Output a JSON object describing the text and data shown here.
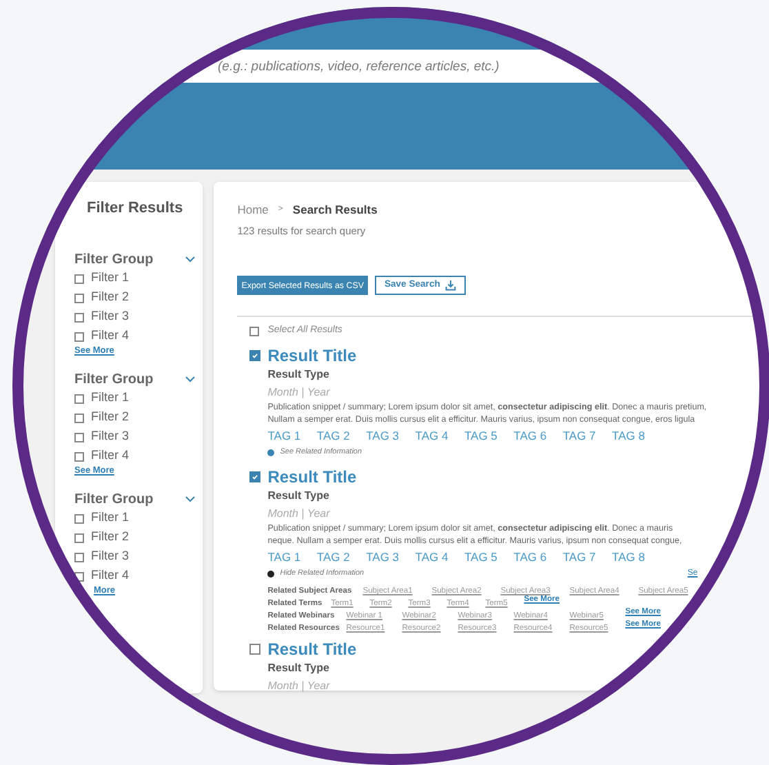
{
  "search": {
    "placeholder": "(e.g.: publications, video, reference articles, etc.)"
  },
  "filters": {
    "title": "Filter Results",
    "groups": [
      {
        "label": "Filter Group",
        "expanded": true,
        "items": [
          {
            "label": "Filter 1",
            "checked": false
          },
          {
            "label": "Filter 2",
            "checked": false
          },
          {
            "label": "Filter 3",
            "checked": false
          },
          {
            "label": "Filter 4",
            "checked": false
          }
        ],
        "see_more": "See More"
      },
      {
        "label": "Filter Group",
        "expanded": true,
        "items": [
          {
            "label": "Filter 1",
            "checked": false
          },
          {
            "label": "Filter 2",
            "checked": false
          },
          {
            "label": "Filter 3",
            "checked": false
          },
          {
            "label": "Filter 4",
            "checked": false
          }
        ],
        "see_more": "See More"
      },
      {
        "label": "Filter Group",
        "expanded": true,
        "items": [
          {
            "label": "Filter 1",
            "checked": false
          },
          {
            "label": "Filter 2",
            "checked": false
          },
          {
            "label": "Filter 3",
            "checked": false
          },
          {
            "label": "Filter 4",
            "checked": false
          }
        ],
        "see_more": "More"
      }
    ]
  },
  "breadcrumb": [
    {
      "label": "Home",
      "current": false
    },
    {
      "label": "Search Results",
      "current": true
    }
  ],
  "breadcrumb_separator": ">",
  "results_count": "123 results for search query",
  "actions": {
    "export": "Export Selected Results as CSV",
    "save": "Save Search"
  },
  "select_all": {
    "label": "Select All Results",
    "checked": false
  },
  "results": [
    {
      "title": "Result Title",
      "selected": true,
      "type": "Result Type",
      "date": "Month | Year",
      "snippet": [
        "Publication snippet / summary; Lorem ipsum dolor sit amet, **consectetur adipiscing elit**. Donec a mauris pretium,",
        "Nullam a semper erat. Duis mollis cursus elit a efficitur. Mauris varius, ipsum non consequat congue, eros ligula"
      ],
      "tags": [
        "TAG 1",
        "TAG 2",
        "TAG 3",
        "TAG 4",
        "TAG 5",
        "TAG 6",
        "TAG 7",
        "TAG 8"
      ],
      "related_toggle": {
        "label": "See Related Information",
        "expanded": false
      }
    },
    {
      "title": "Result Title",
      "selected": true,
      "type": "Result Type",
      "date": "Month | Year",
      "snippet": [
        "Publication snippet / summary; Lorem ipsum dolor sit amet, **consectetur adipiscing elit**. Donec a mauris",
        "neque. Nullam a semper erat. Duis mollis cursus elit a efficitur. Mauris varius, ipsum non consequat congue,"
      ],
      "tags": [
        "TAG 1",
        "TAG 2",
        "TAG 3",
        "TAG 4",
        "TAG 5",
        "TAG 6",
        "TAG 7",
        "TAG 8"
      ],
      "related_toggle": {
        "label": "Hide Related Information",
        "expanded": true,
        "side_link": "Se"
      },
      "related": [
        {
          "kind": "wide",
          "label": "Related Subject Areas",
          "links": [
            "Subject Area1",
            "Subject Area2",
            "Subject Area3",
            "Subject Area4",
            "Subject Area5"
          ]
        },
        {
          "kind": "narrow",
          "label": "Related Terms",
          "links": [
            "Term1",
            "Term2",
            "Term3",
            "Term4",
            "Term5"
          ],
          "see_more": "See More"
        },
        {
          "kind": "medium",
          "label": "Related Webinars",
          "links": [
            "Webinar 1",
            "Webinar2",
            "Webinar3",
            "Webinar4",
            "Webinar5"
          ],
          "see_more": "See More"
        },
        {
          "kind": "medium",
          "label": "Related Resources",
          "links": [
            "Resource1",
            "Resource2",
            "Resource3",
            "Resource4",
            "Resource5"
          ],
          "see_more": "See More"
        }
      ]
    },
    {
      "title": "Result Title",
      "selected": false,
      "type": "Result Type",
      "date": "Month | Year"
    }
  ]
}
